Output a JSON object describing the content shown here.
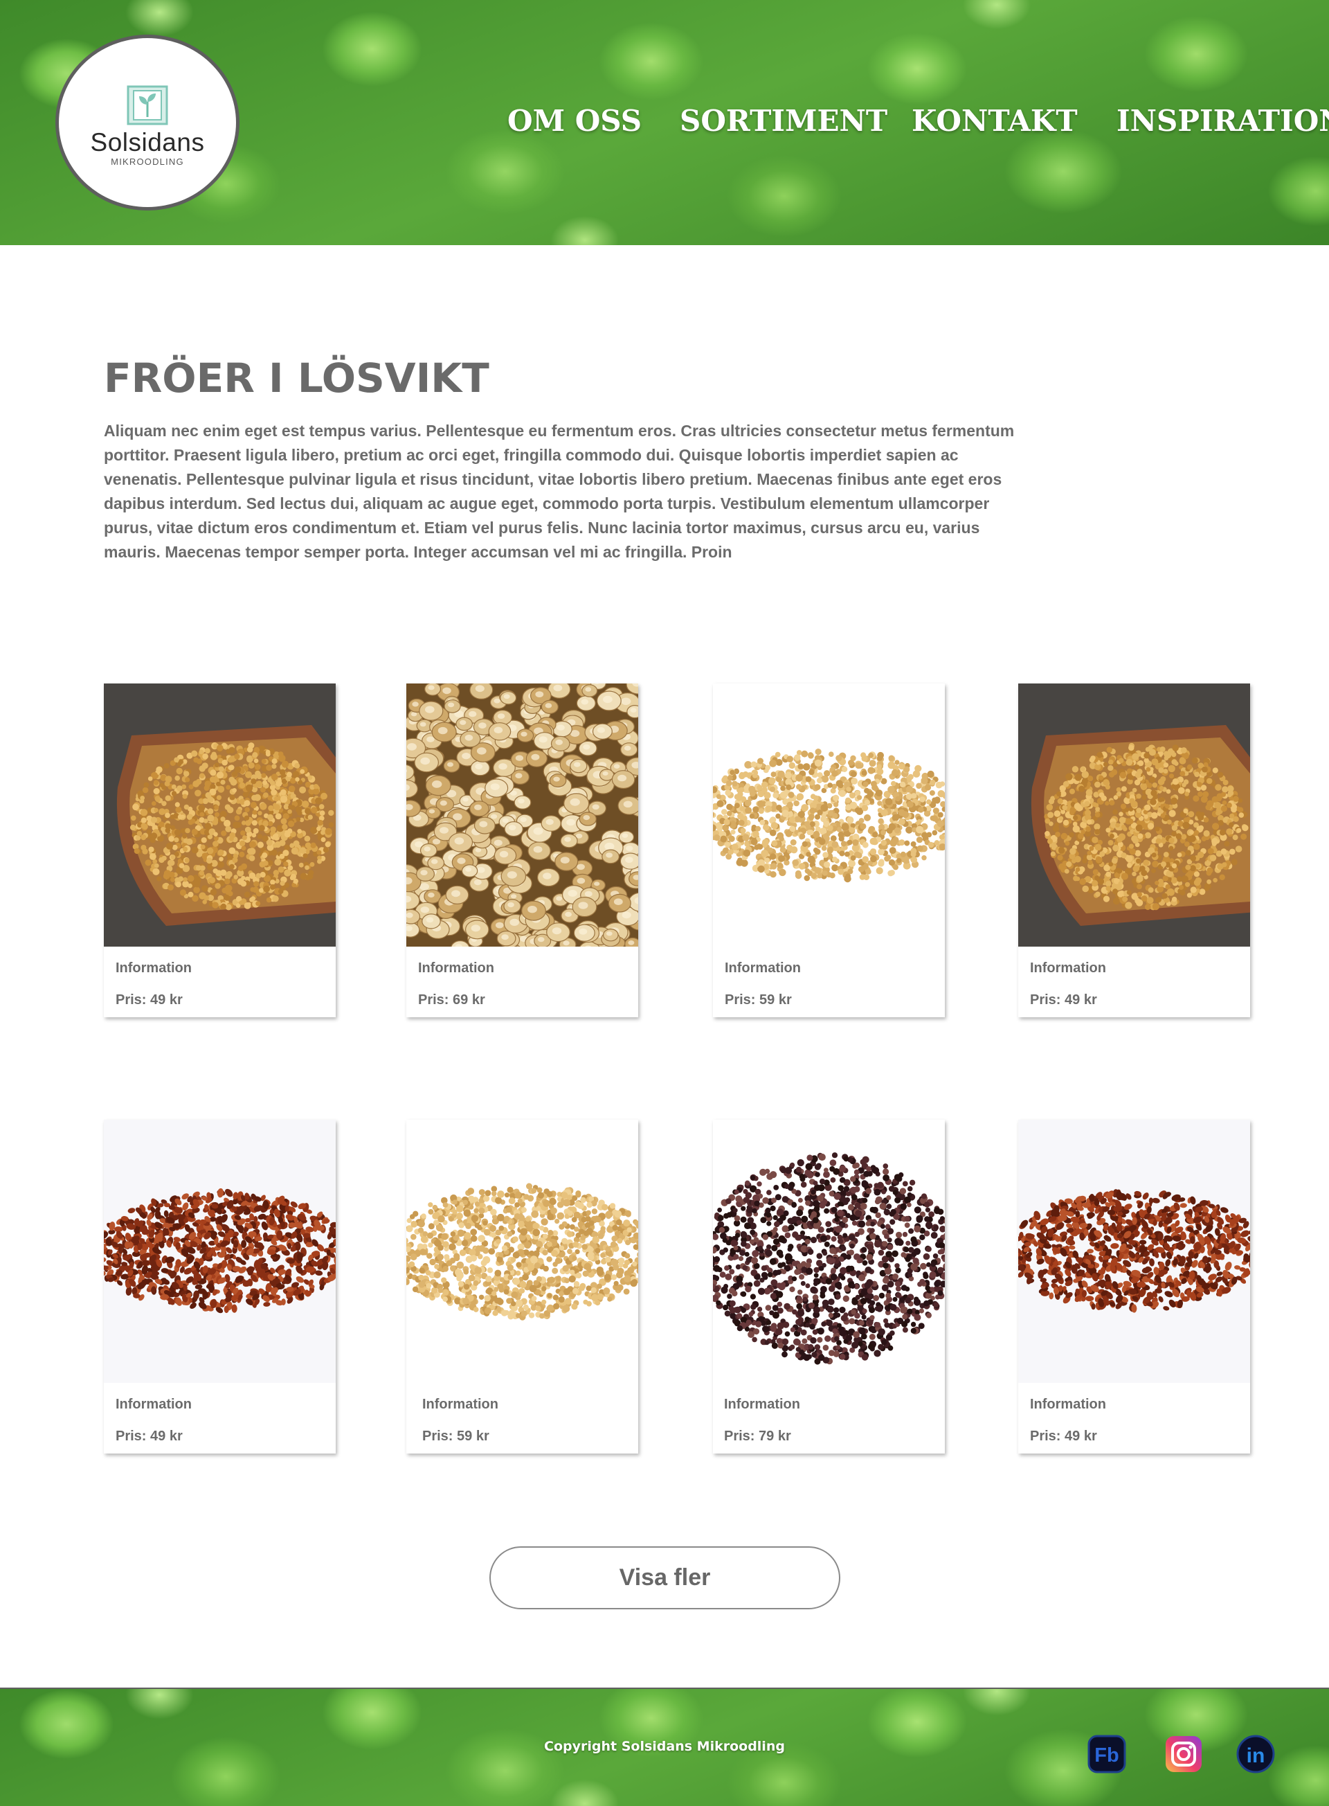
{
  "header": {
    "logo": {
      "name": "Solsidans",
      "subtitle": "MIKROODLING"
    },
    "nav": [
      {
        "label": "OM OSS"
      },
      {
        "label": "SORTIMENT"
      },
      {
        "label": "KONTAKT"
      },
      {
        "label": "INSPIRATION"
      }
    ]
  },
  "main": {
    "title": "FRÖER I LÖSVIKT",
    "intro": "Aliquam nec enim eget est tempus varius. Pellentesque eu fermentum eros. Cras ultricies consectetur metus fermentum porttitor. Praesent ligula libero, pretium ac orci eget, fringilla commodo dui. Quisque lobortis imperdiet sapien ac venenatis. Pellentesque pulvinar ligula et risus tincidunt, vitae lobortis libero pretium. Maecenas finibus ante eget eros dapibus interdum. Sed lectus dui, aliquam ac augue eget, commodo porta turpis. Vestibulum elementum ullamcorper purus, vitae dictum eros condimentum et. Etiam vel purus felis. Nunc lacinia tortor maximus, cursus arcu eu, varius mauris. Maecenas tempor semper porta. Integer accumsan vel mi ac fringilla. Proin",
    "products": [
      {
        "info": "Information",
        "price": "Pris: 49 kr",
        "image": "mustard-seeds-in-wooden-bowl"
      },
      {
        "info": "Information",
        "price": "Pris: 69 kr",
        "image": "quinoa-closeup"
      },
      {
        "info": "Information",
        "price": "Pris: 59 kr",
        "image": "mustard-seed-pile"
      },
      {
        "info": "Information",
        "price": "Pris: 49 kr",
        "image": "mustard-seeds-in-wooden-bowl"
      },
      {
        "info": "Information",
        "price": "Pris: 49 kr",
        "image": "red-seed-pile"
      },
      {
        "info": "Information",
        "price": "Pris: 59 kr",
        "image": "mustard-seed-pile"
      },
      {
        "info": "Information",
        "price": "Pris: 79 kr",
        "image": "dark-seed-pile"
      },
      {
        "info": "Information",
        "price": "Pris: 49 kr",
        "image": "red-seed-pile"
      }
    ],
    "more_button": "Visa fler"
  },
  "footer": {
    "copyright": "Copyright Solsidans Mikroodling",
    "social": [
      {
        "icon": "facebook-icon",
        "label": "Fb"
      },
      {
        "icon": "instagram-icon"
      },
      {
        "icon": "linkedin-icon",
        "label": "in"
      }
    ]
  }
}
